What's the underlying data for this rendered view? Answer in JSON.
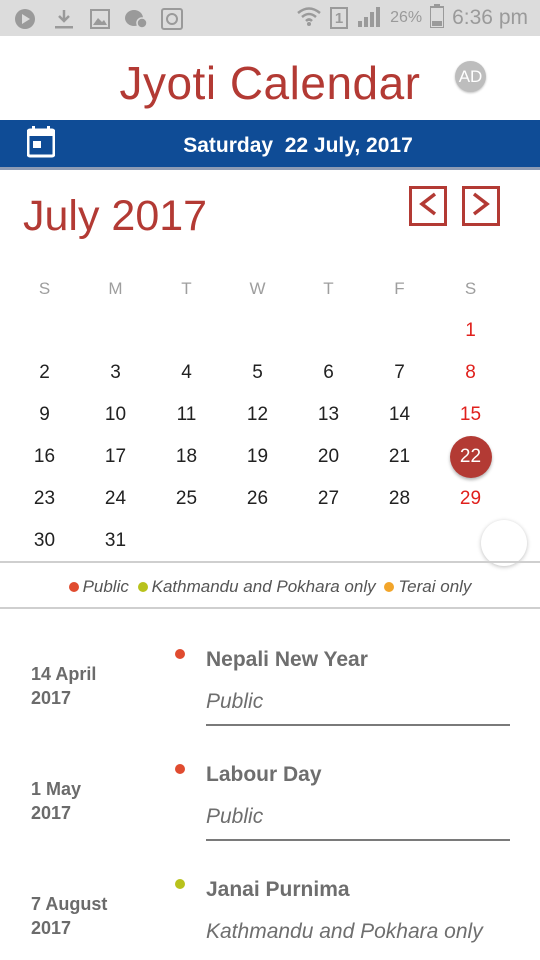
{
  "status_bar": {
    "battery_percent": "26%",
    "time": "6:36 pm",
    "sim_label": "1",
    "icons": [
      "play-icon",
      "download-icon",
      "image-icon",
      "chat-icon",
      "viber-icon",
      "wifi-icon",
      "sim-icon",
      "signal-icon",
      "battery-icon"
    ]
  },
  "header": {
    "title": "Jyoti Calendar",
    "ad_badge": "AD",
    "today_label": "Saturday  22 July, 2017"
  },
  "calendar": {
    "month_title": "July 2017",
    "prev_label": "<",
    "next_label": ">",
    "weekdays": [
      "S",
      "M",
      "T",
      "W",
      "T",
      "F",
      "S"
    ],
    "leading_blanks": 6,
    "days": [
      "1",
      "2",
      "3",
      "4",
      "5",
      "6",
      "7",
      "8",
      "9",
      "10",
      "11",
      "12",
      "13",
      "14",
      "15",
      "16",
      "17",
      "18",
      "19",
      "20",
      "21",
      "22",
      "23",
      "24",
      "25",
      "26",
      "27",
      "28",
      "29",
      "30",
      "31"
    ],
    "today": "22"
  },
  "legend": [
    {
      "label": "Public",
      "color": "#e04b2f"
    },
    {
      "label": "Kathmandu and Pokhara only",
      "color": "#b8c21c"
    },
    {
      "label": "Terai only",
      "color": "#f2a52a"
    }
  ],
  "holidays": [
    {
      "date_line1": "14 April",
      "date_line2": "2017",
      "name": "Nepali New Year",
      "type": "Public",
      "color": "#e04b2f"
    },
    {
      "date_line1": "1 May",
      "date_line2": "2017",
      "name": "Labour Day",
      "type": "Public",
      "color": "#e04b2f"
    },
    {
      "date_line1": "7 August",
      "date_line2": "2017",
      "name": "Janai Purnima",
      "type": "Kathmandu and Pokhara only",
      "color": "#b8c21c"
    }
  ],
  "colors": {
    "brand_red": "#b33a34",
    "date_bar_blue": "#0f4c96",
    "saturday_red": "#e0201c"
  }
}
